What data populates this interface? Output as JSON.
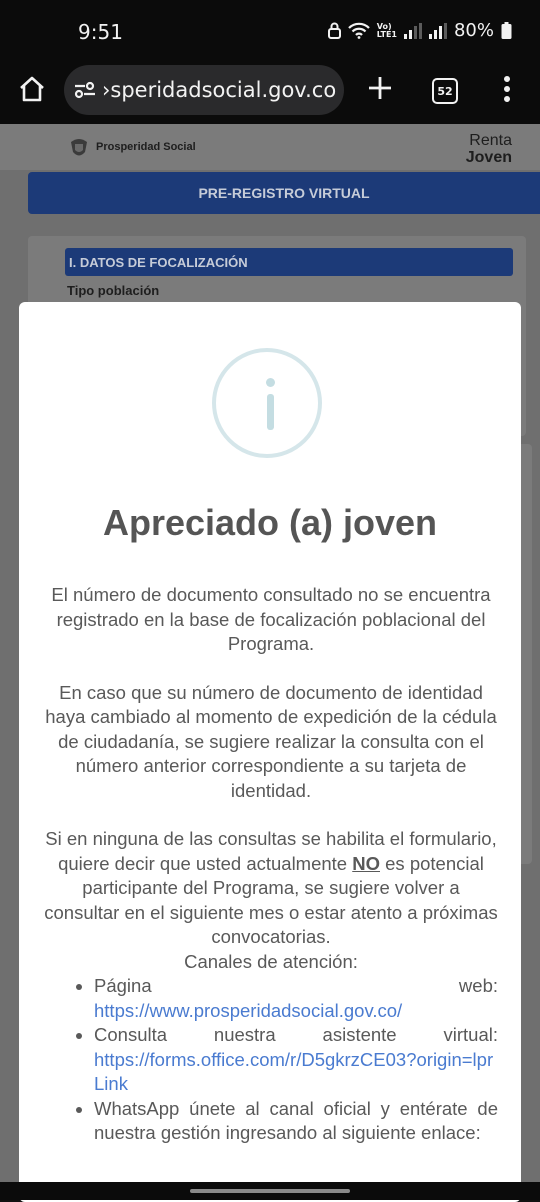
{
  "status": {
    "time": "9:51",
    "battery": "80%",
    "volte": "Vo)\nLTE1"
  },
  "browser": {
    "url": "›speridadsocial.gov.co",
    "tab_count": "52",
    "icons": [
      "home-icon",
      "site-settings-icon",
      "new-tab-icon",
      "tabs-icon",
      "more-icon"
    ]
  },
  "site": {
    "logo_text": "Prosperidad Social",
    "brand_line1": "Renta",
    "brand_line2": "Joven",
    "banner": "PRE-REGISTRO VIRTUAL",
    "section_title": "I. DATOS DE FOCALIZACIÓN",
    "field_label": "Tipo población"
  },
  "modal": {
    "icon": "info-icon",
    "title": "Apreciado (a) joven",
    "para1": "El número de documento consultado no se encuentra registrado en la base de focalización poblacional del Programa.",
    "para2": "En caso que su número de documento de identidad haya cambiado al momento de expedición de la cédula de ciudadanía, se sugiere realizar la consulta con el número anterior correspondiente a su tarjeta de identidad.",
    "para3_start": "Si en ninguna de las consultas se habilita el formulario, quiere decir que usted actualmente ",
    "para3_no": "NO",
    "para3_end": " es potencial participante del Programa, se sugiere volver a consultar en el siguiente mes o estar atento a próximas convocatorias.",
    "channels_title": "Canales de atención:",
    "channels": [
      {
        "text": "Página web:",
        "link": "https://www.prosperidadsocial.gov.co/"
      },
      {
        "text": "Consulta nuestra asistente virtual:",
        "link": "https://forms.office.com/r/D5gkrzCE03?origin=lprLink"
      },
      {
        "text": "WhatsApp únete al canal oficial y entérate de nuestra gestión ingresando al siguiente enlace:"
      }
    ]
  },
  "colors": {
    "accent": "#1c3a78",
    "link": "#4a7bd0",
    "info_ring": "#d5e6ea"
  }
}
